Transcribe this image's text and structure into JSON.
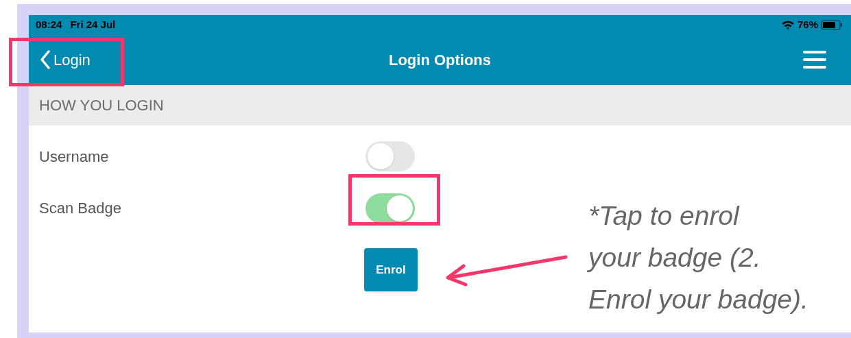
{
  "status_bar": {
    "time": "08:24",
    "date": "Fri 24 Jul",
    "battery": "76%"
  },
  "nav_bar": {
    "back": "Login",
    "title": "Login Options"
  },
  "section": {
    "header": "HOW YOU LOGIN"
  },
  "options": [
    {
      "label": "Username",
      "on": false
    },
    {
      "label": "Scan Badge",
      "on": true
    }
  ],
  "enrol_button": "Enrol",
  "annotation": {
    "note_lines": [
      "*Tap to enrol",
      "your badge (2.",
      "Enrol your badge)."
    ]
  }
}
